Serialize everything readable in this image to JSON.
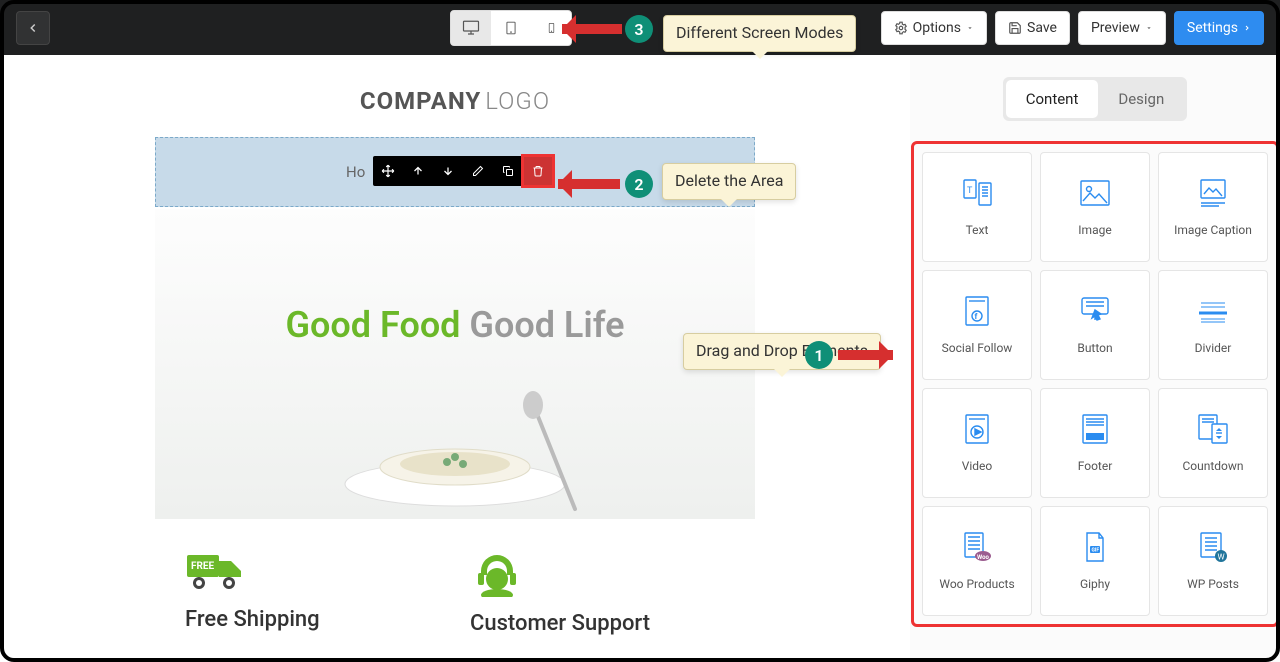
{
  "topbar": {
    "options_label": "Options",
    "save_label": "Save",
    "preview_label": "Preview",
    "settings_label": "Settings"
  },
  "logo": {
    "bold": "COMPANY",
    "light": "LOGO"
  },
  "nav_item": "Ho",
  "hero": {
    "word1": "Good Food",
    "word2": "Good Life"
  },
  "features": [
    {
      "title": "Free Shipping"
    },
    {
      "title": "Customer Support"
    }
  ],
  "tabs": {
    "content": "Content",
    "design": "Design"
  },
  "elements": [
    "Text",
    "Image",
    "Image Caption",
    "Social Follow",
    "Button",
    "Divider",
    "Video",
    "Footer",
    "Countdown",
    "Woo Products",
    "Giphy",
    "WP Posts"
  ],
  "annotations": {
    "a1": "Drag and Drop Elements",
    "a2": "Delete the Area",
    "a3": "Different Screen Modes"
  },
  "badges": {
    "b1": "1",
    "b2": "2",
    "b3": "3"
  }
}
